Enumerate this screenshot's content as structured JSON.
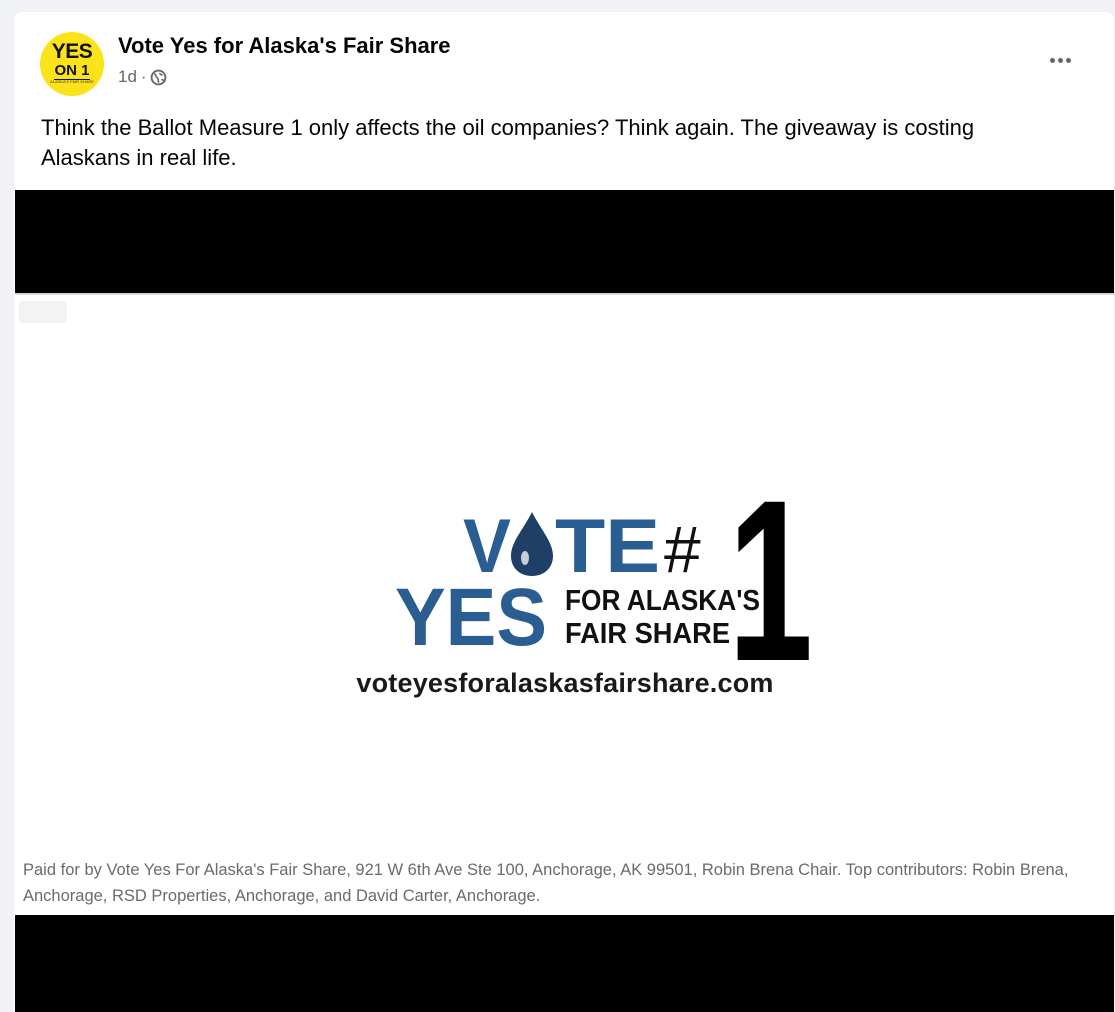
{
  "post": {
    "page_name": "Vote Yes for Alaska's Fair Share",
    "timestamp": "1d",
    "separator": "·",
    "audience_icon": "globe-icon",
    "more_icon": "more-options-icon",
    "text": "Think the Ballot Measure 1 only affects the oil companies? Think again. The giveaway is costing Alaskans in real life."
  },
  "avatar": {
    "line1": "YES",
    "line2": "ON 1",
    "line3": "ALASKA'S FAIR SHARE",
    "background": "#fbe31b"
  },
  "video": {
    "logo": {
      "vote": "VOTE",
      "yes": "YES",
      "hash": "#",
      "number": "1",
      "for_line1": "FOR ALASKA'S",
      "for_line2": "FAIR SHARE",
      "blue": "#2a5d92",
      "drop_color": "#1f3f66"
    },
    "url": "voteyesforalaskasfairshare.com",
    "disclaimer": "Paid for by Vote Yes For Alaska's Fair Share, 921 W 6th Ave Ste 100, Anchorage, AK 99501, Robin Brena Chair. Top contributors: Robin Brena, Anchorage, RSD Properties, Anchorage, and David Carter, Anchorage."
  }
}
